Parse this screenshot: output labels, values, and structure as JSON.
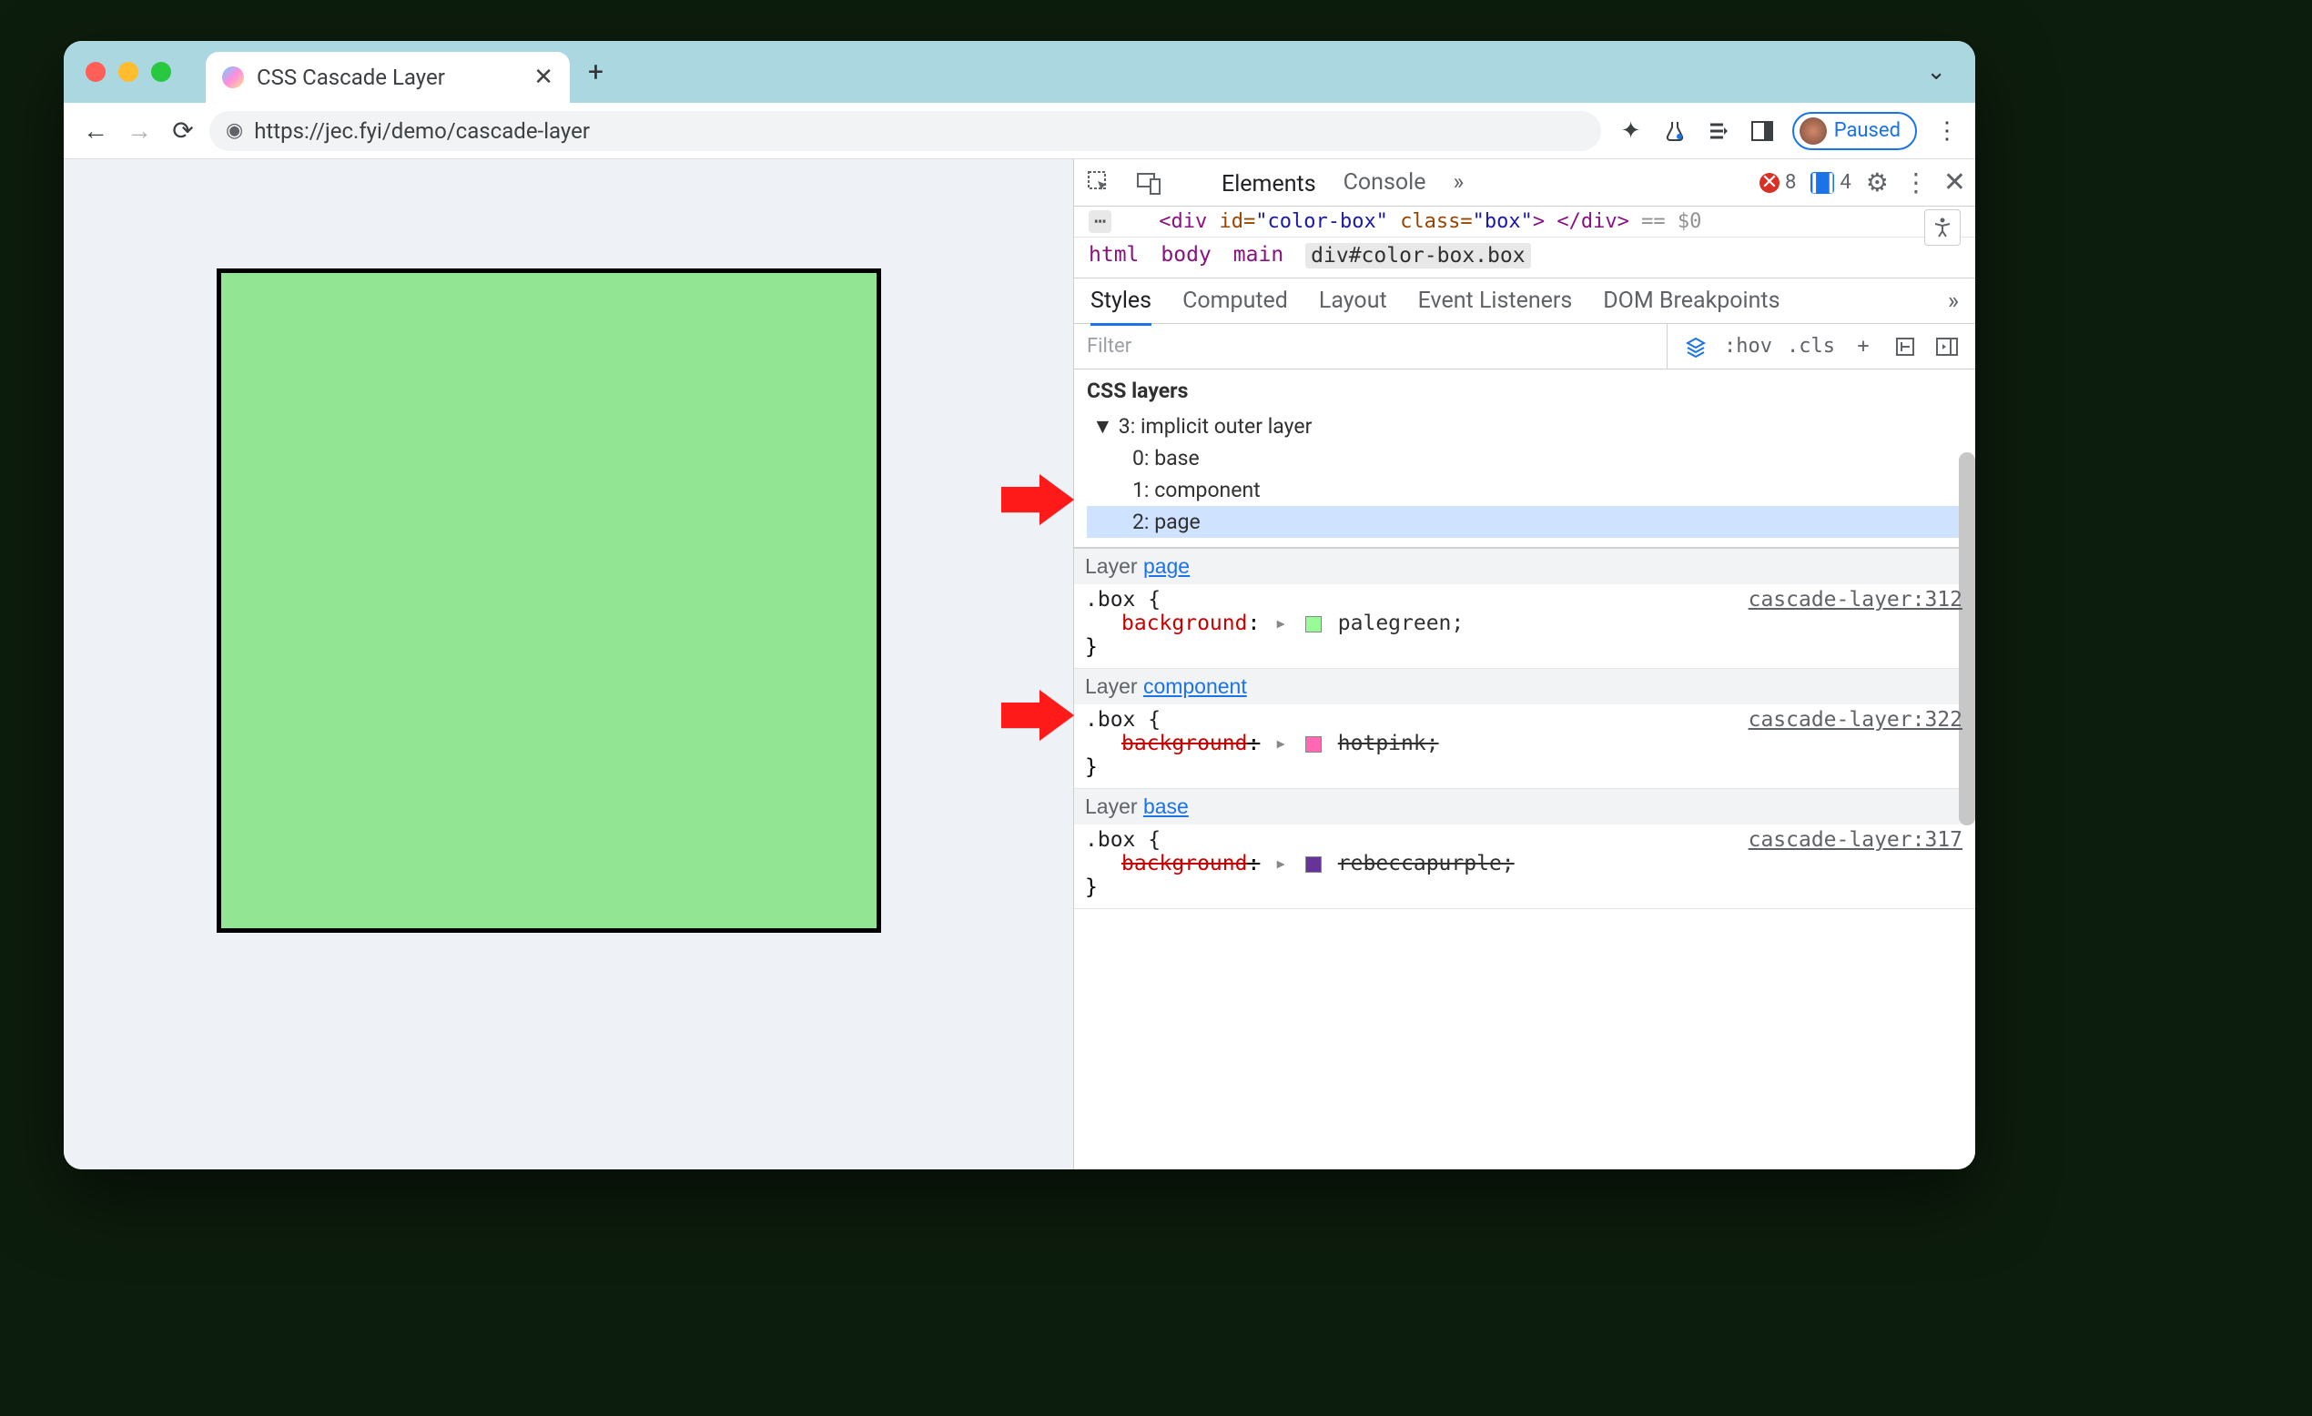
{
  "browser": {
    "tab_title": "CSS Cascade Layer",
    "url": "https://jec.fyi/demo/cascade-layer",
    "paused_label": "Paused"
  },
  "page": {
    "box_color": "#92e592"
  },
  "devtools": {
    "tabs": {
      "elements": "Elements",
      "console": "Console"
    },
    "badges": {
      "errors": "8",
      "messages": "4"
    },
    "dom_line_prefix": "<div",
    "dom_attr_id_name": "id",
    "dom_attr_id_val": "\"color-box\"",
    "dom_attr_class_name": "class",
    "dom_attr_class_val": "\"box\"",
    "dom_line_mid": ">",
    "dom_line_close": "</div>",
    "dom_line_suffix": "== $0",
    "crumbs": {
      "c1": "html",
      "c2": "body",
      "c3": "main",
      "c4": "div#color-box.box"
    },
    "subtabs": {
      "styles": "Styles",
      "computed": "Computed",
      "layout": "Layout",
      "events": "Event Listeners",
      "dombp": "DOM Breakpoints"
    },
    "filter_placeholder": "Filter",
    "filter_tools": {
      "hov": ":hov",
      "cls": ".cls",
      "plus": "+"
    },
    "layers": {
      "title": "CSS layers",
      "root": "3: implicit outer layer",
      "i0": "0: base",
      "i1": "1: component",
      "i2": "2: page"
    },
    "rules": {
      "layer_word": "Layer ",
      "page_name": "page",
      "component_name": "component",
      "base_name": "base",
      "selector": ".box {",
      "brace_close": "}",
      "prop_bg": "background",
      "src_page": "cascade-layer:312",
      "src_component": "cascade-layer:322",
      "src_base": "cascade-layer:317",
      "val_palegreen": "palegreen;",
      "val_hotpink": "hotpink;",
      "val_rebecca": "rebeccapurple;"
    }
  }
}
